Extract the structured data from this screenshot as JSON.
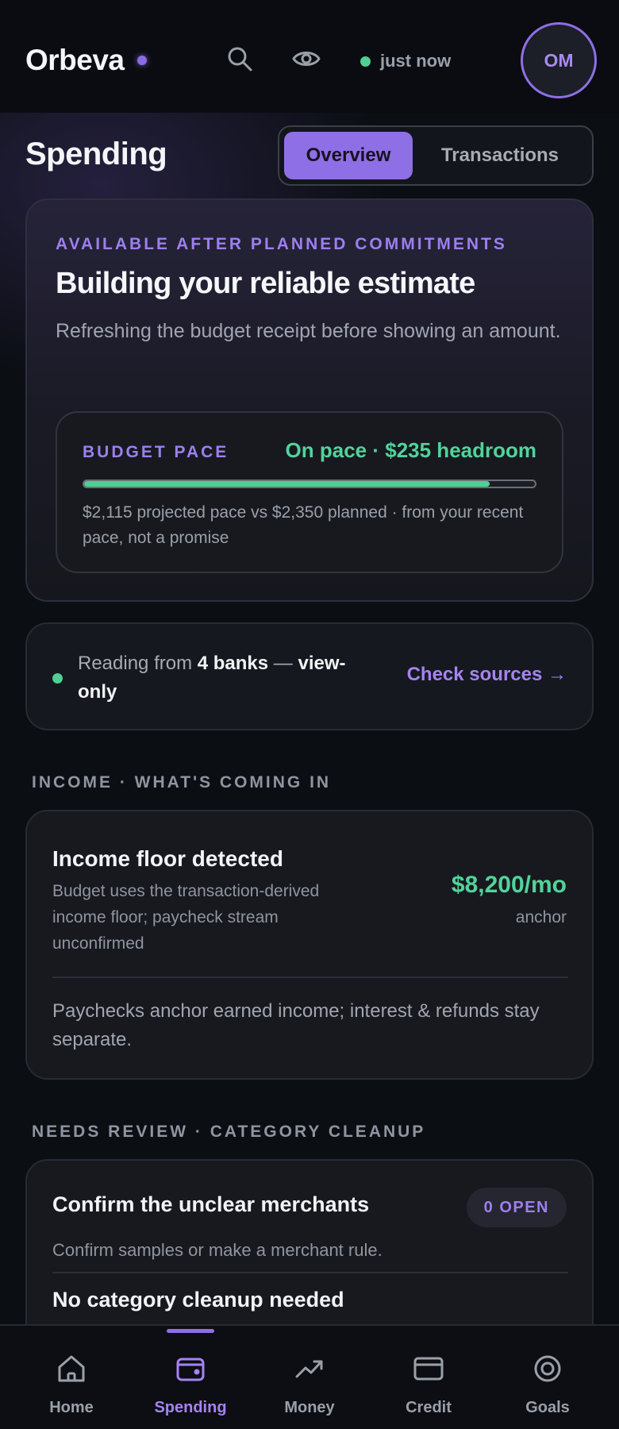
{
  "header": {
    "brand": "Orbeva",
    "sync_status": "just now",
    "avatar_initials": "OM"
  },
  "page": {
    "title": "Spending",
    "tabs": [
      {
        "label": "Overview",
        "active": true
      },
      {
        "label": "Transactions",
        "active": false
      }
    ]
  },
  "estimate": {
    "eyebrow": "AVAILABLE AFTER PLANNED COMMITMENTS",
    "title": "Building your reliable estimate",
    "body": "Refreshing the budget receipt before showing an amount.",
    "pace": {
      "label": "BUDGET PACE",
      "status": "On pace · $235 headroom",
      "progress_fraction": 0.9,
      "note": "$2,115 projected pace vs $2,350 planned · from your recent pace, not a promise"
    }
  },
  "sources": {
    "prefix": "Reading from ",
    "banks": "4 banks",
    "separator": " — ",
    "mode": "view-only",
    "link": "Check sources →"
  },
  "income": {
    "section_label": "INCOME · WHAT'S COMING IN",
    "title": "Income floor detected",
    "description": "Budget uses the transaction-derived income floor; paycheck stream unconfirmed",
    "amount": "$8,200/mo",
    "amount_caption": "anchor",
    "note": "Paychecks anchor earned income; interest & refunds stay separate."
  },
  "review": {
    "section_label": "NEEDS REVIEW · CATEGORY CLEANUP",
    "title": "Confirm the unclear merchants",
    "badge": "0 OPEN",
    "description": "Confirm samples or make a merchant rule.",
    "empty_title": "No category cleanup needed"
  },
  "nav": {
    "items": [
      {
        "label": "Home",
        "icon": "home-icon"
      },
      {
        "label": "Spending",
        "icon": "wallet-icon",
        "active": true
      },
      {
        "label": "Money",
        "icon": "trend-icon"
      },
      {
        "label": "Credit",
        "icon": "card-icon"
      },
      {
        "label": "Goals",
        "icon": "target-icon"
      }
    ]
  },
  "colors": {
    "accent": "#8f6fe6",
    "positive": "#4fcf94",
    "background": "#0b0e13"
  }
}
